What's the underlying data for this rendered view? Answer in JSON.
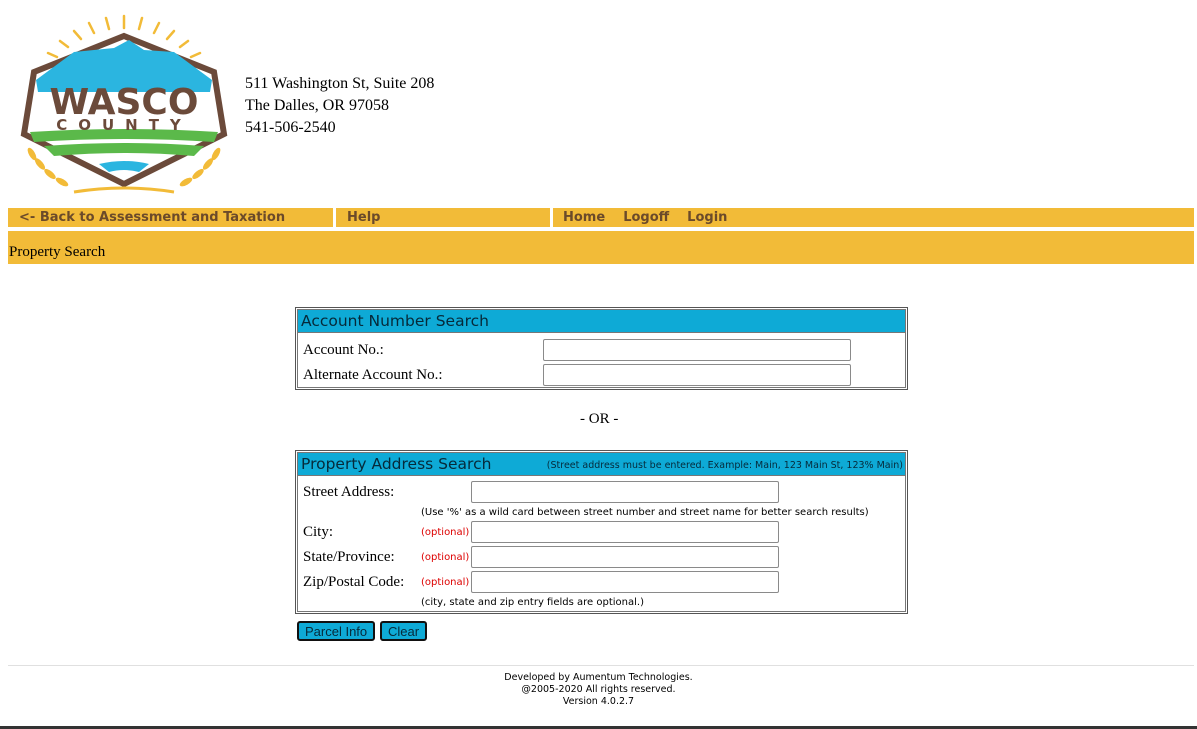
{
  "header": {
    "logo_text_main": "WASCO",
    "logo_text_sub": "COUNTY",
    "address_line1": "511 Washington St, Suite 208",
    "address_line2": "The Dalles, OR 97058",
    "phone": "541-506-2540"
  },
  "nav": {
    "back_label": "<- Back to Assessment and Taxation",
    "help_label": "Help",
    "home_label": "Home",
    "logoff_label": "Logoff",
    "login_label": "Login"
  },
  "page_title": "Property Search",
  "account_search": {
    "title": "Account Number Search",
    "account_label": "Account No.:",
    "account_value": "",
    "alt_account_label": "Alternate Account No.:",
    "alt_account_value": ""
  },
  "or_text": "- OR -",
  "address_search": {
    "title": "Property Address Search",
    "note": "(Street address must be entered. Example: Main, 123 Main St, 123% Main)",
    "street_label": "Street Address:",
    "street_value": "",
    "wildcard_hint": "(Use '%' as a wild card between street number and street name for better search results)",
    "city_label": "City:",
    "city_value": "",
    "state_label": "State/Province:",
    "state_value": "",
    "zip_label": "Zip/Postal Code:",
    "zip_value": "",
    "optional_text": "(optional)",
    "optional_hint": "(city, state and zip entry fields are optional.)"
  },
  "buttons": {
    "parcel_info": "Parcel Info",
    "clear": "Clear"
  },
  "footer": {
    "line1": "Developed by Aumentum Technologies.",
    "line2": "@2005-2020 All rights reserved.",
    "line3": "Version 4.0.2.7"
  },
  "colors": {
    "brand_gold": "#f2bb38",
    "panel_blue": "#0eaad6",
    "nav_text": "#6b4a2a",
    "optional_red": "#dd0000"
  }
}
